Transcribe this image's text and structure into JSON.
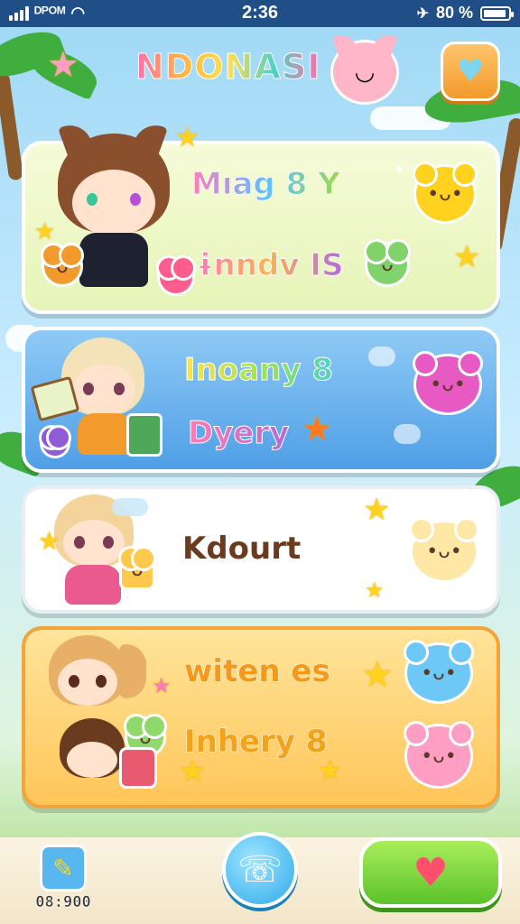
{
  "status_bar": {
    "carrier": "ᴰᴾᴼᴹ",
    "time": "2:36",
    "battery": "80 %",
    "battery_level": 0.8
  },
  "header": {
    "title": "NDONASI",
    "favorite_icon": "heart-icon"
  },
  "cards": [
    {
      "color": "#eef8c8",
      "labels": [
        "Mıag 8 Y",
        "ɨnndv IS"
      ]
    },
    {
      "color": "#6fb4ee",
      "labels": [
        "Inoany 8",
        "Dyery"
      ]
    },
    {
      "color": "#ffffff",
      "labels": [
        "Kdourt"
      ]
    },
    {
      "color": "#ffd77e",
      "labels": [
        "witen es",
        "Inhery 8"
      ]
    }
  ],
  "bottom_bar": {
    "counter": "08:900",
    "edit_icon": "pencil-icon",
    "call_icon": "phone-icon",
    "like_icon": "heart-icon"
  }
}
